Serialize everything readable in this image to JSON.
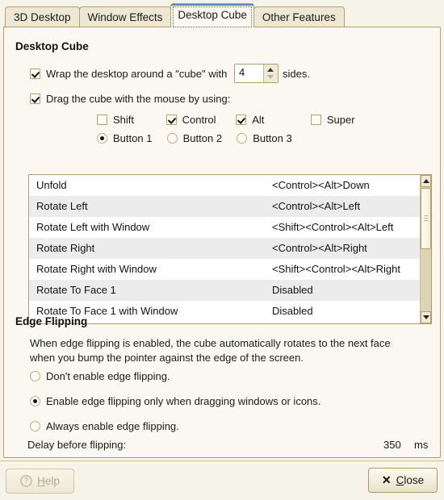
{
  "window": {
    "tabs": [
      {
        "label": "3D Desktop",
        "active": false
      },
      {
        "label": "Window Effects",
        "active": false
      },
      {
        "label": "Desktop Cube",
        "active": true
      },
      {
        "label": "Other Features",
        "active": false
      }
    ]
  },
  "cube_section": {
    "title": "Desktop Cube",
    "wrap": {
      "label_before": "Wrap the desktop around a \"cube\" with",
      "label_after": "sides.",
      "checked": true,
      "sides_value": "4"
    },
    "drag": {
      "label": "Drag the cube with the mouse by using:",
      "checked": true,
      "modifiers": [
        {
          "label": "Shift",
          "checked": false
        },
        {
          "label": "Control",
          "checked": true
        },
        {
          "label": "Alt",
          "checked": true
        },
        {
          "label": "Super",
          "checked": false
        }
      ],
      "buttons": [
        {
          "label": "Button 1",
          "selected": true
        },
        {
          "label": "Button 2",
          "selected": false
        },
        {
          "label": "Button 3",
          "selected": false
        }
      ]
    },
    "shortcuts": {
      "rows": [
        {
          "action": "Unfold",
          "binding": "<Control><Alt>Down"
        },
        {
          "action": "Rotate Left",
          "binding": "<Control><Alt>Left"
        },
        {
          "action": "Rotate Left with Window",
          "binding": "<Shift><Control><Alt>Left"
        },
        {
          "action": "Rotate Right",
          "binding": "<Control><Alt>Right"
        },
        {
          "action": "Rotate Right with Window",
          "binding": "<Shift><Control><Alt>Right"
        },
        {
          "action": "Rotate To Face 1",
          "binding": "Disabled"
        },
        {
          "action": "Rotate To Face 1 with Window",
          "binding": "Disabled"
        }
      ]
    }
  },
  "edge_section": {
    "title": "Edge Flipping",
    "description_line1": "When edge flipping is enabled, the cube automatically rotates to the next face",
    "description_line2": "when you bump the pointer against the edge of the screen.",
    "options": [
      {
        "label": "Don't enable edge flipping.",
        "selected": false
      },
      {
        "label": "Enable edge flipping only when dragging windows or icons.",
        "selected": true
      },
      {
        "label": "Always enable edge flipping.",
        "selected": false
      }
    ],
    "delay": {
      "label": "Delay before flipping:",
      "value": "350",
      "unit": "ms"
    }
  },
  "footer": {
    "help_label": "Help",
    "help_accel": "H",
    "close_label": "Close",
    "close_accel": "C",
    "help_icon": "question-circle-icon",
    "close_icon": "x-icon"
  },
  "colors": {
    "accent_blue": "#4a7fbd",
    "panel_bg": "#faf8f0",
    "window_bg": "#f6f3e8",
    "border": "#b59e6a"
  }
}
